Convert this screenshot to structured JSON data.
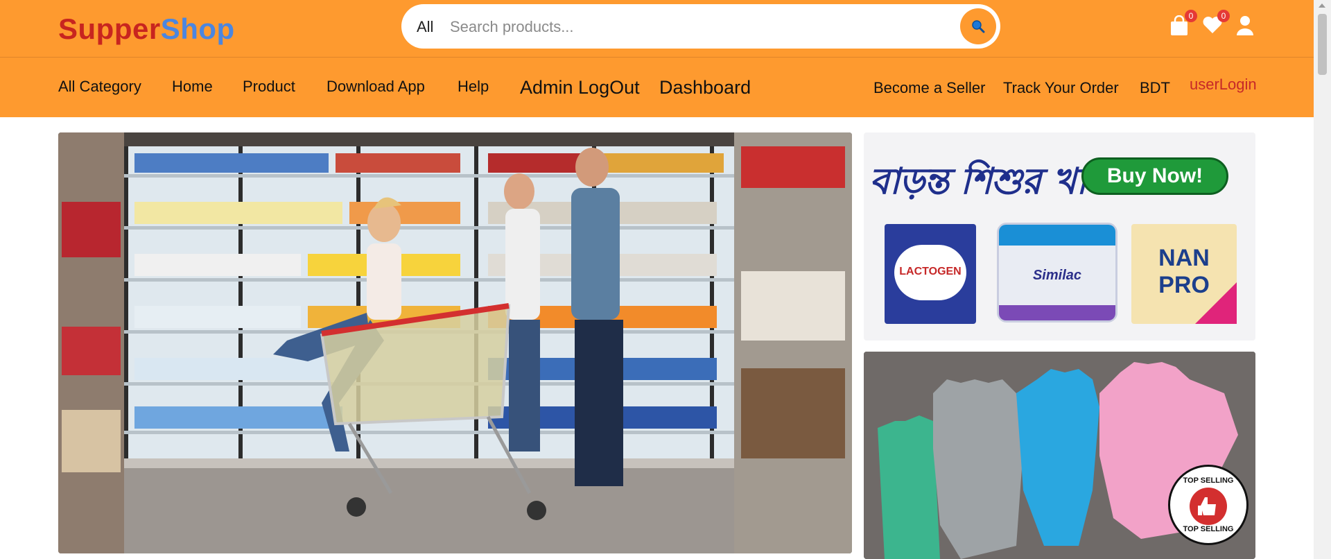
{
  "header": {
    "logo_part1": "Supper",
    "logo_part2": "Shop",
    "search": {
      "category": "All",
      "placeholder": "Search products..."
    },
    "cart_count": "0",
    "wishlist_count": "0"
  },
  "nav": {
    "all_category": "All Category",
    "home": "Home",
    "product": "Product",
    "download_app": "Download App",
    "help": "Help",
    "admin_logout": "Admin LogOut",
    "dashboard": "Dashboard",
    "become_seller": "Become a Seller",
    "track_order": "Track Your Order",
    "currency": "BDT",
    "user_login": "userLogin"
  },
  "banner1": {
    "headline": "বাড়ন্ত শিশুর খাদ্য",
    "cta": "Buy Now!",
    "products": [
      "LACTOGEN",
      "Similac",
      "NAN PRO"
    ]
  },
  "banner2": {
    "stamp_top": "TOP SELLING",
    "stamp_bottom": "TOP SELLING"
  },
  "colors": {
    "header_bg": "#fe9a2f",
    "logo_red": "#c8251f",
    "logo_blue": "#4b86e0",
    "login_red": "#c62828"
  }
}
